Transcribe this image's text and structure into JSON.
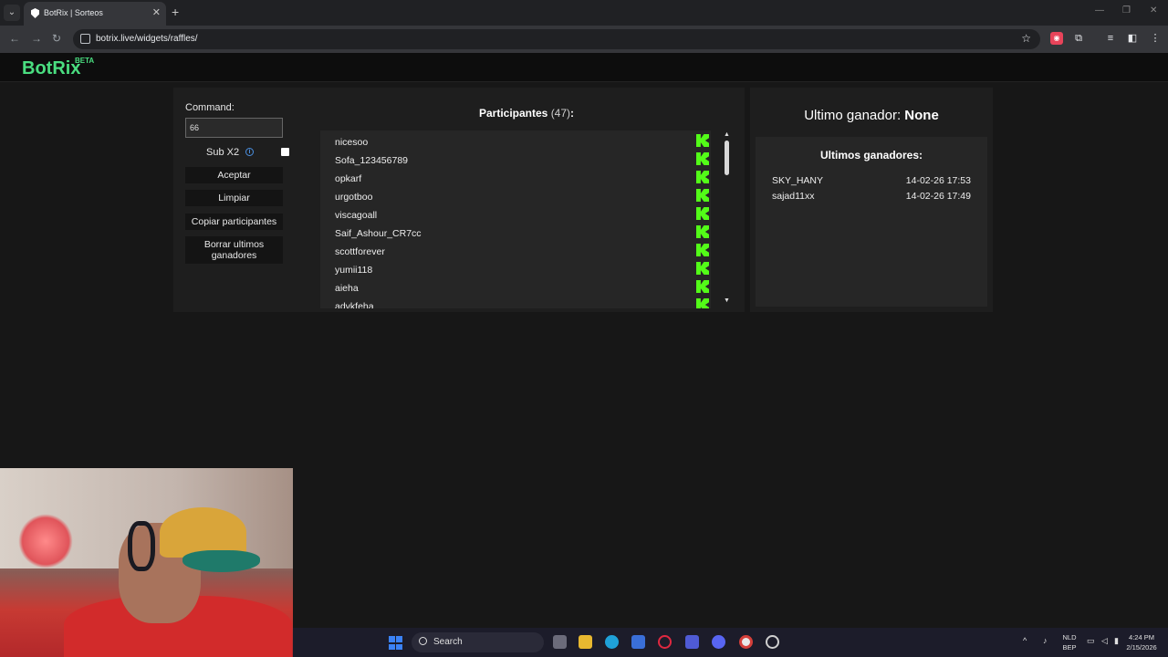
{
  "browser": {
    "tab_title": "BotRix | Sorteos",
    "url": "botrix.live/widgets/raffles/"
  },
  "site": {
    "logo": "BotRix",
    "logo_badge": "BETA"
  },
  "controls": {
    "command_label": "Command:",
    "command_value": "66",
    "subx2_label": "Sub X2",
    "subx2_checked": false,
    "buttons": {
      "accept": "Aceptar",
      "clear": "Limpiar",
      "copy_participants": "Copiar participantes",
      "delete_winners": "Borrar ultimos ganadores"
    }
  },
  "participants": {
    "title": "Participantes",
    "count": "(47)",
    "colon": ":",
    "items": [
      "nicesoo",
      "Sofa_123456789",
      "opkarf",
      "urgotboo",
      "viscagoall",
      "Saif_Ashour_CR7cc",
      "scottforever",
      "yumii118",
      "aieha",
      "advkfeha"
    ]
  },
  "winners": {
    "last_label": "Ultimo ganador:",
    "last_value": "None",
    "recent_title": "Ultimos ganadores:",
    "recent": [
      {
        "name": "SKY_HANY",
        "date": "14-02-26 17:53"
      },
      {
        "name": "sajad11xx",
        "date": "14-02-26 17:49"
      }
    ]
  },
  "taskbar": {
    "search_label": "Search",
    "lang_top": "NLD",
    "lang_bottom": "BEP",
    "time": "4:24 PM",
    "date": "2/15/2026"
  },
  "colors": {
    "accent_green": "#4ade80",
    "kick_green": "#53fc18",
    "panel_bg": "#1e1e1e",
    "page_bg": "#171717"
  }
}
